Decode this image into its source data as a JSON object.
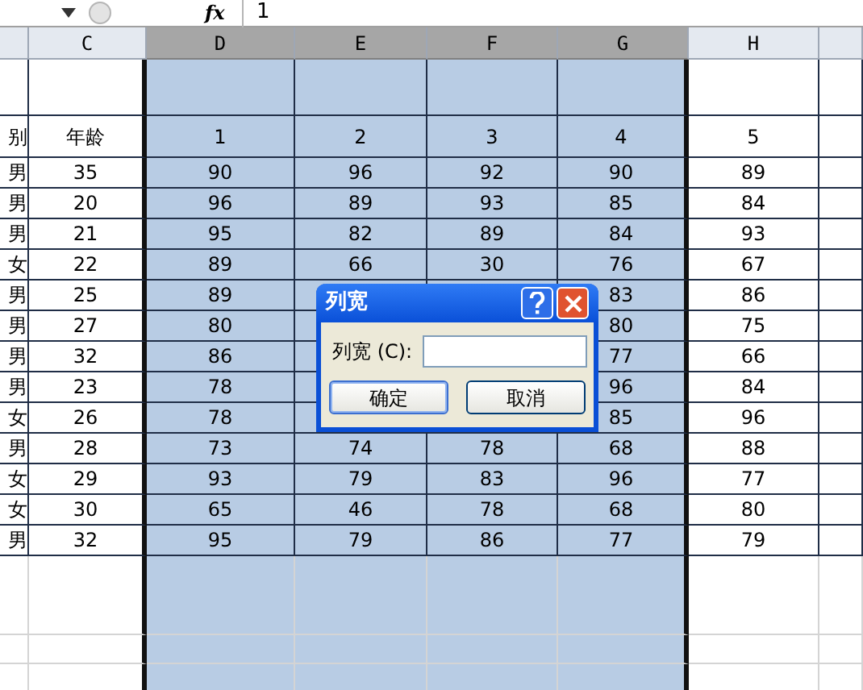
{
  "formula_bar": {
    "function_label": "fx",
    "value": "1"
  },
  "columns": [
    {
      "selected": false
    },
    {
      "label": "C",
      "selected": false
    },
    {
      "label": "D",
      "selected": true
    },
    {
      "label": "E",
      "selected": true
    },
    {
      "label": "F",
      "selected": true
    },
    {
      "label": "G",
      "selected": true
    },
    {
      "label": "H",
      "selected": false
    },
    {
      "selected": false
    }
  ],
  "header_row": [
    "别",
    "年龄",
    "1",
    "2",
    "3",
    "4",
    "5"
  ],
  "rows": [
    [
      "男",
      "35",
      "90",
      "96",
      "92",
      "90",
      "89"
    ],
    [
      "男",
      "20",
      "96",
      "89",
      "93",
      "85",
      "84"
    ],
    [
      "男",
      "21",
      "95",
      "82",
      "89",
      "84",
      "93"
    ],
    [
      "女",
      "22",
      "89",
      "66",
      "30",
      "76",
      "67"
    ],
    [
      "男",
      "25",
      "89",
      null,
      null,
      "83",
      "86"
    ],
    [
      "男",
      "27",
      "80",
      null,
      null,
      "80",
      "75"
    ],
    [
      "男",
      "32",
      "86",
      null,
      null,
      "77",
      "66"
    ],
    [
      "男",
      "23",
      "78",
      null,
      null,
      "96",
      "84"
    ],
    [
      "女",
      "26",
      "78",
      null,
      null,
      "85",
      "96"
    ],
    [
      "男",
      "28",
      "73",
      "74",
      "78",
      "68",
      "88"
    ],
    [
      "女",
      "29",
      "93",
      "79",
      "83",
      "96",
      "77"
    ],
    [
      "女",
      "30",
      "65",
      "46",
      "78",
      "68",
      "80"
    ],
    [
      "男",
      "32",
      "95",
      "79",
      "86",
      "77",
      "79"
    ]
  ],
  "dialog": {
    "title": "列宽",
    "field_label": "列宽 (C):",
    "buttons": [
      {
        "label": "确定",
        "selected": true
      },
      {
        "label": "取消",
        "selected": false
      }
    ]
  }
}
